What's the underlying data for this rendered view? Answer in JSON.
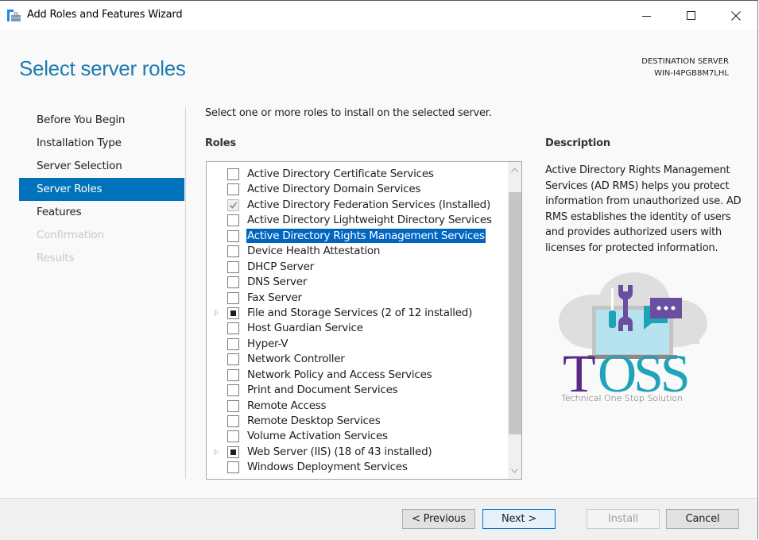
{
  "window": {
    "title": "Add Roles and Features Wizard",
    "controls": [
      "minimize-icon",
      "maximize-icon",
      "close-icon"
    ]
  },
  "header": {
    "page_title": "Select server roles",
    "destination_label": "DESTINATION SERVER",
    "destination_server": "WIN-I4PGB8M7LHL"
  },
  "nav": {
    "items": [
      {
        "label": "Before You Begin",
        "state": "normal"
      },
      {
        "label": "Installation Type",
        "state": "normal"
      },
      {
        "label": "Server Selection",
        "state": "normal"
      },
      {
        "label": "Server Roles",
        "state": "active"
      },
      {
        "label": "Features",
        "state": "normal"
      },
      {
        "label": "Confirmation",
        "state": "disabled"
      },
      {
        "label": "Results",
        "state": "disabled"
      }
    ]
  },
  "main": {
    "instruction": "Select one or more roles to install on the selected server.",
    "roles_heading": "Roles",
    "roles": [
      {
        "label": "Active Directory Certificate Services",
        "state": "unchecked",
        "expandable": false
      },
      {
        "label": "Active Directory Domain Services",
        "state": "unchecked",
        "expandable": false
      },
      {
        "label": "Active Directory Federation Services (Installed)",
        "state": "installed",
        "expandable": false
      },
      {
        "label": "Active Directory Lightweight Directory Services",
        "state": "unchecked",
        "expandable": false
      },
      {
        "label": "Active Directory Rights Management Services",
        "state": "unchecked",
        "expandable": false,
        "selected": true
      },
      {
        "label": "Device Health Attestation",
        "state": "unchecked",
        "expandable": false
      },
      {
        "label": "DHCP Server",
        "state": "unchecked",
        "expandable": false
      },
      {
        "label": "DNS Server",
        "state": "unchecked",
        "expandable": false
      },
      {
        "label": "Fax Server",
        "state": "unchecked",
        "expandable": false
      },
      {
        "label": "File and Storage Services (2 of 12 installed)",
        "state": "partial",
        "expandable": true
      },
      {
        "label": "Host Guardian Service",
        "state": "unchecked",
        "expandable": false
      },
      {
        "label": "Hyper-V",
        "state": "unchecked",
        "expandable": false
      },
      {
        "label": "Network Controller",
        "state": "unchecked",
        "expandable": false
      },
      {
        "label": "Network Policy and Access Services",
        "state": "unchecked",
        "expandable": false
      },
      {
        "label": "Print and Document Services",
        "state": "unchecked",
        "expandable": false
      },
      {
        "label": "Remote Access",
        "state": "unchecked",
        "expandable": false
      },
      {
        "label": "Remote Desktop Services",
        "state": "unchecked",
        "expandable": false
      },
      {
        "label": "Volume Activation Services",
        "state": "unchecked",
        "expandable": false
      },
      {
        "label": "Web Server (IIS) (18 of 43 installed)",
        "state": "partial",
        "expandable": true
      },
      {
        "label": "Windows Deployment Services",
        "state": "unchecked",
        "expandable": false
      }
    ],
    "scroll": {
      "thumb_start_fraction": 0.05,
      "thumb_end_fraction": 0.9
    }
  },
  "description": {
    "heading": "Description",
    "text": "Active Directory Rights Management Services (AD RMS) helps you protect information from unauthorized use. AD RMS establishes the identity of users and provides authorized users with licenses for protected information."
  },
  "watermark": {
    "logo_text": "TOSS",
    "tagline": "Technical One Stop Solution",
    "colors": {
      "purple": "#5b2a86",
      "teal": "#1fa3b8",
      "cloud": "#dedede",
      "screen": "#b7e3f0",
      "bubble": "#6a4fa0"
    }
  },
  "footer": {
    "previous_label": "< Previous",
    "next_label": "Next >",
    "install_label": "Install",
    "cancel_label": "Cancel",
    "install_enabled": false
  },
  "colors": {
    "accent": "#0072bc",
    "title_blue": "#1e7bb0",
    "selection": "#0065c1"
  }
}
